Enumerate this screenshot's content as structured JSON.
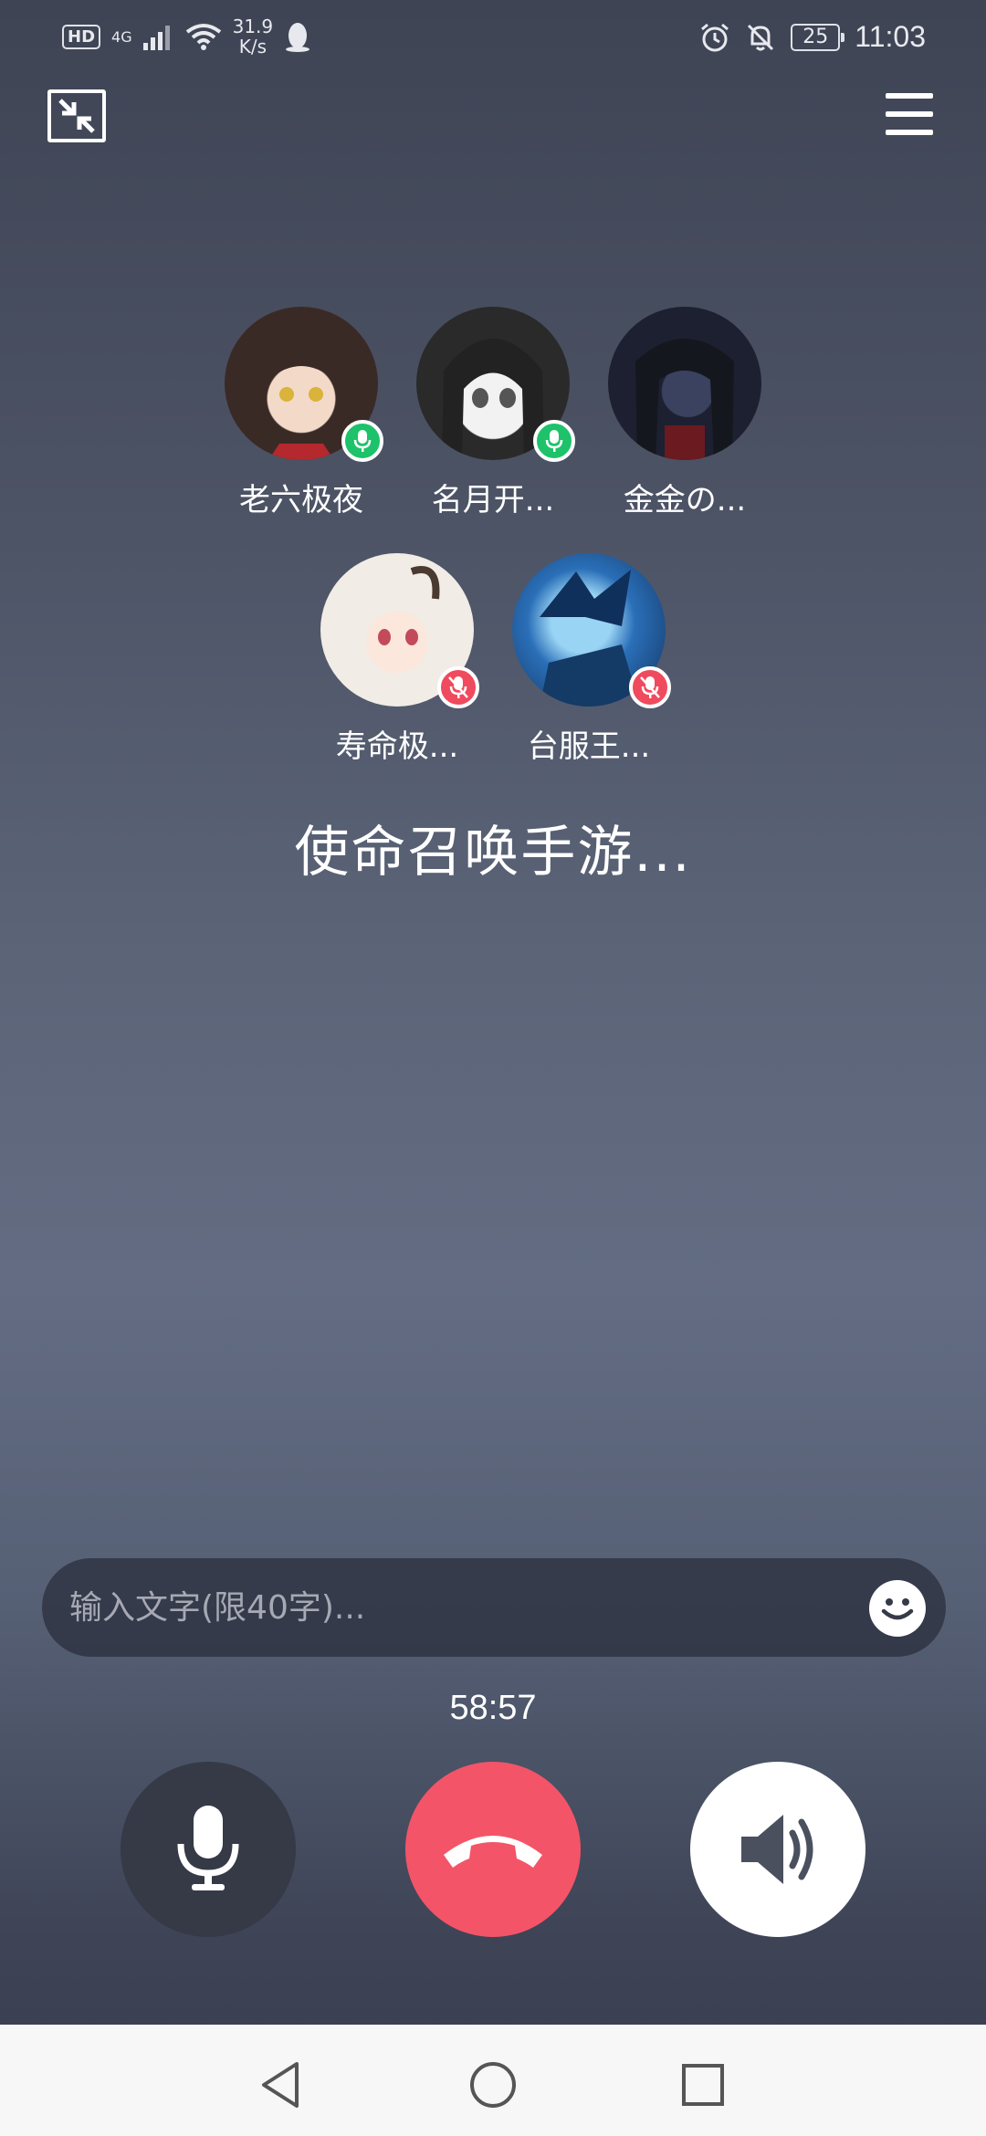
{
  "status_bar": {
    "hd_label": "HD",
    "network_label": "4G",
    "speed_value": "31.9",
    "speed_unit": "K/s",
    "battery": "25",
    "time": "11:03"
  },
  "toolbar": {
    "minimize_icon": "shrink-window-icon",
    "menu_icon": "hamburger-menu-icon"
  },
  "participants": [
    {
      "name": "老六极夜",
      "mic": "on"
    },
    {
      "name": "名月开...",
      "mic": "on"
    },
    {
      "name": "金金の...",
      "mic": "none"
    },
    {
      "name": "寿命极...",
      "mic": "off"
    },
    {
      "name": "台服王...",
      "mic": "off"
    }
  ],
  "room": {
    "title": "使命召唤手游..."
  },
  "chat": {
    "placeholder": "输入文字(限40字)...",
    "emoji_icon": "smiley-icon"
  },
  "call": {
    "duration": "58:57",
    "mic_icon": "microphone-icon",
    "hangup_icon": "hang-up-icon",
    "speaker_icon": "speaker-icon",
    "hangup_color": "#f45467"
  },
  "nav": {
    "back_icon": "back-triangle-icon",
    "home_icon": "home-circle-icon",
    "recents_icon": "recents-square-icon"
  },
  "colors": {
    "mic_on": "#1dc26a",
    "mic_off": "#f04a5e"
  }
}
